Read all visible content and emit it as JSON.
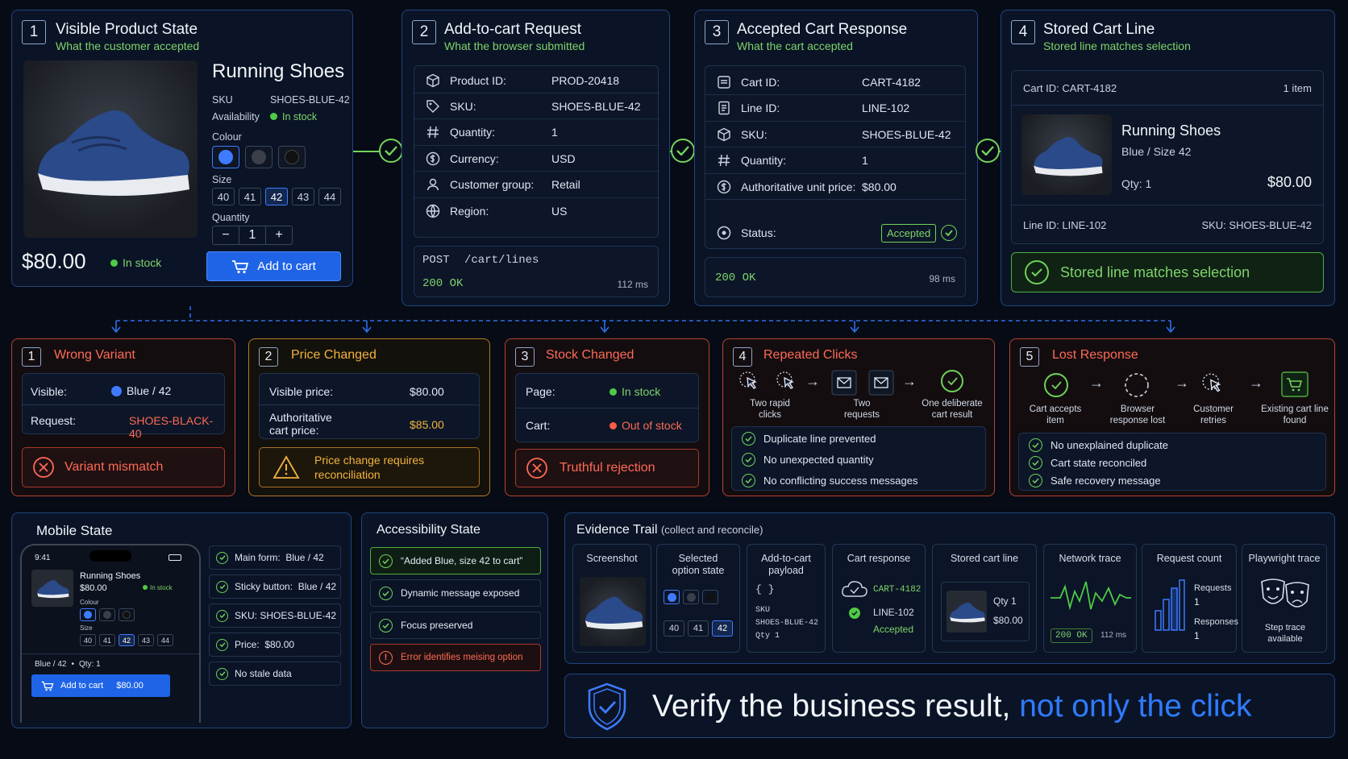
{
  "flow": [
    {
      "num": "1",
      "title": "Visible Product State",
      "subtitle": "What the customer accepted"
    },
    {
      "num": "2",
      "title": "Add-to-cart Request",
      "subtitle": "What the browser submitted"
    },
    {
      "num": "3",
      "title": "Accepted Cart Response",
      "subtitle": "What the cart accepted"
    },
    {
      "num": "4",
      "title": "Stored Cart Line",
      "subtitle": "Stored line matches selection"
    }
  ],
  "product": {
    "name": "Running Shoes",
    "sku_label": "SKU",
    "sku": "SHOES-BLUE-42",
    "availability_label": "Availability",
    "availability": "In stock",
    "colour_label": "Colour",
    "size_label": "Size",
    "sizes": [
      "40",
      "41",
      "42",
      "43",
      "44"
    ],
    "selected_size": "42",
    "quantity_label": "Quantity",
    "quantity": "1",
    "minus": "−",
    "plus": "+",
    "price": "$80.00",
    "stock": "In stock",
    "add_to_cart": "Add to cart"
  },
  "request": {
    "rows": [
      {
        "label": "Product ID:",
        "value": "PROD-20418",
        "icon": "box-icon"
      },
      {
        "label": "SKU:",
        "value": "SHOES-BLUE-42",
        "icon": "tag-icon"
      },
      {
        "label": "Quantity:",
        "value": "1",
        "icon": "hash-icon"
      },
      {
        "label": "Currency:",
        "value": "USD",
        "icon": "dollar-icon"
      },
      {
        "label": "Customer group:",
        "value": "Retail",
        "icon": "user-icon"
      },
      {
        "label": "Region:",
        "value": "US",
        "icon": "globe-icon"
      }
    ],
    "method": "POST",
    "path": "/cart/lines",
    "status": "200 OK",
    "time": "112 ms"
  },
  "response": {
    "rows": [
      {
        "label": "Cart ID:",
        "value": "CART-4182",
        "icon": "cart-icon"
      },
      {
        "label": "Line ID:",
        "value": "LINE-102",
        "icon": "doc-icon"
      },
      {
        "label": "SKU:",
        "value": "SHOES-BLUE-42",
        "icon": "box-icon"
      },
      {
        "label": "Quantity:",
        "value": "1",
        "icon": "hash-icon"
      },
      {
        "label": "Authoritative unit price:",
        "value": "$80.00",
        "icon": "dollar-icon"
      }
    ],
    "status_label": "Status:",
    "status_value": "Accepted",
    "http": "200 OK",
    "time": "98 ms"
  },
  "stored": {
    "cart_id": "Cart ID: CART-4182",
    "items": "1 item",
    "name": "Running Shoes",
    "variant": "Blue / Size 42",
    "qty": "Qty: 1",
    "price": "$80.00",
    "line_id": "Line ID: LINE-102",
    "sku": "SKU: SHOES-BLUE-42",
    "match": "Stored line matches selection"
  },
  "failures": {
    "wrong_variant": {
      "num": "1",
      "title": "Wrong Variant",
      "visible_label": "Visible:",
      "visible_value": "Blue / 42",
      "request_label": "Request:",
      "request_value": "SHOES-BLACK-40",
      "result": "Variant mismatch"
    },
    "price_changed": {
      "num": "2",
      "title": "Price Changed",
      "visible_label": "Visible price:",
      "visible_value": "$80.00",
      "auth_label": "Authoritative cart price:",
      "auth_value": "$85.00",
      "result": "Price change requires reconciliation"
    },
    "stock_changed": {
      "num": "3",
      "title": "Stock Changed",
      "page_label": "Page:",
      "page_value": "In stock",
      "cart_label": "Cart:",
      "cart_value": "Out of stock",
      "result": "Truthful rejection"
    },
    "repeated_clicks": {
      "num": "4",
      "title": "Repeated Clicks",
      "steps": [
        "Two rapid clicks",
        "Two requests",
        "One deliberate cart result"
      ],
      "checks": [
        "Duplicate line prevented",
        "No unexpected quantity",
        "No conflicting success messages"
      ]
    },
    "lost_response": {
      "num": "5",
      "title": "Lost Response",
      "steps": [
        "Cart accepts item",
        "Browser response lost",
        "Customer retries",
        "Existing cart line found"
      ],
      "checks": [
        "No unexplained duplicate",
        "Cart state reconciled",
        "Safe recovery message"
      ]
    }
  },
  "mobile": {
    "title": "Mobile State",
    "time": "9:41",
    "name": "Running Shoes",
    "price": "$80.00",
    "stock": "In stock",
    "colour_label": "Colour",
    "size_label": "Size",
    "sizes": [
      "40",
      "41",
      "42",
      "43",
      "44"
    ],
    "summary": "Blue / 42",
    "qty": "Qty: 1",
    "button": "Add to cart",
    "button_price": "$80.00",
    "checks": [
      "Main form:  Blue / 42",
      "Sticky button:  Blue / 42",
      "SKU: SHOES-BLUE-42",
      "Price:  $80.00",
      "No stale data"
    ]
  },
  "accessibility": {
    "title": "Accessibility State",
    "checks": [
      "“Added Blue, size 42 to cart”",
      "Dynamic message exposed",
      "Focus preserved"
    ],
    "error": "Error identifies meising option"
  },
  "evidence": {
    "title": "Evidence Trail",
    "subtitle": "(collect and reconcile)",
    "screenshot": "Screenshot",
    "selected": "Selected option state",
    "sizes": [
      "40",
      "41",
      "42"
    ],
    "payload": "Add-to-cart payload",
    "payload_braces": "{ }",
    "payload_sku_label": "SKU",
    "payload_sku": "SHOES-BLUE-42",
    "payload_qty": "Qty  1",
    "cart_response": "Cart response",
    "cart_id": "CART-4182",
    "line_id": "LINE-102",
    "accepted": "Accepted",
    "stored": "Stored cart line",
    "stored_qty": "Qty 1",
    "stored_price": "$80.00",
    "network": "Network trace",
    "network_status": "200 OK",
    "network_time": "112 ms",
    "count": "Request count",
    "requests_label": "Requests",
    "requests": "1",
    "responses_label": "Responses",
    "responses": "1",
    "playwright": "Playwright trace",
    "playwright_sub": "Step trace available"
  },
  "banner": {
    "part1": "Verify the business result,",
    "part2": "not only the click"
  },
  "colors": {
    "accent": "#3e7bff",
    "success": "#74d35b",
    "error": "#ff6a54",
    "warning": "#f2b33d"
  }
}
